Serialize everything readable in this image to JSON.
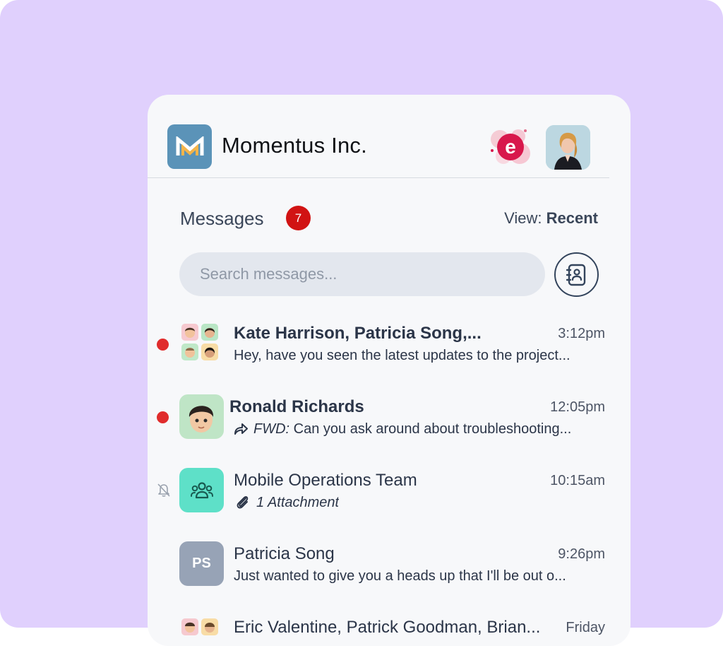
{
  "header": {
    "company": "Momentus Inc.",
    "logo_icon": "momentus-logo-m",
    "brand_badge_letter": "e"
  },
  "messages": {
    "title": "Messages",
    "unread_count": "7",
    "view_label": "View:",
    "view_value": "Recent"
  },
  "search": {
    "placeholder": "Search messages..."
  },
  "conversations": [
    {
      "name": "Kate Harrison, Patricia Song,...",
      "time": "3:12pm",
      "preview": "Hey, have you seen the latest updates to the project...",
      "unread": true,
      "avatar": "group-memoji-grid"
    },
    {
      "name": "Ronald Richards",
      "time": "12:05pm",
      "preview_prefix": "FWD:",
      "preview": "Can you ask around about troubleshooting...",
      "unread": true,
      "avatar": "memoji-boy"
    },
    {
      "name": "Mobile Operations Team",
      "time": "10:15am",
      "preview": "1 Attachment",
      "muted": true,
      "avatar": "team-icon"
    },
    {
      "name": "Patricia Song",
      "time": "9:26pm",
      "preview": "Just wanted to give you a heads up that I'll be out o...",
      "initials": "PS"
    },
    {
      "name": "Eric Valentine, Patrick Goodman, Brian...",
      "time": "Friday",
      "avatar": "group-memoji-grid"
    }
  ],
  "colors": {
    "background": "#e0d0fd",
    "card": "#f7f8fa",
    "badge": "#d11313",
    "unread_dot": "#e02c2c",
    "team_avatar": "#5ee0c8",
    "initials_avatar": "#97a3b6"
  }
}
